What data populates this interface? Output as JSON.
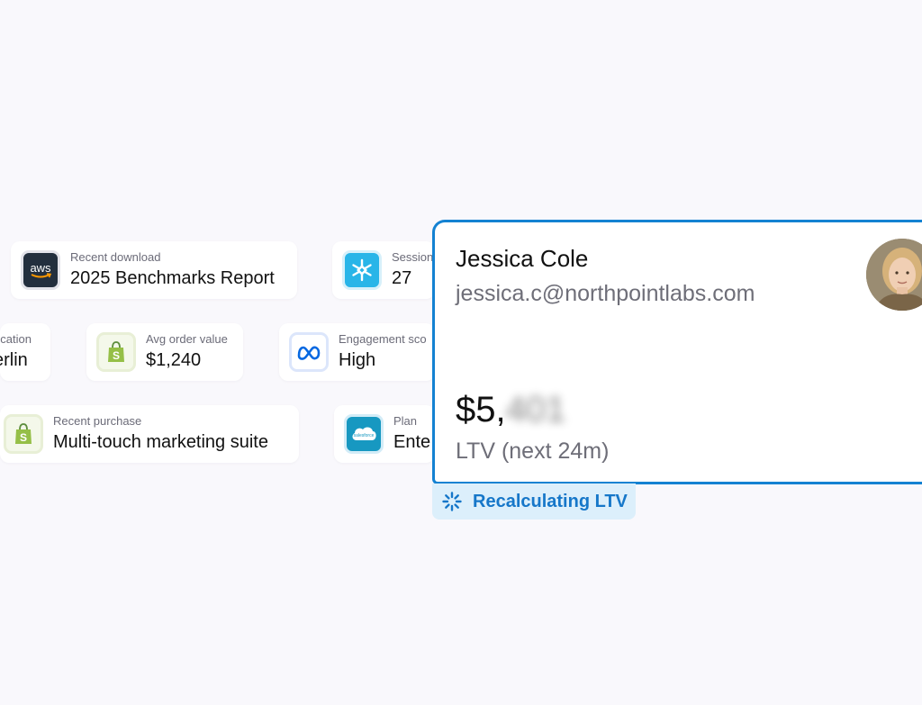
{
  "cards": {
    "recent_download": {
      "label": "Recent download",
      "value": "2025 Benchmarks Report"
    },
    "sessions": {
      "label": "Session",
      "value": "27"
    },
    "location": {
      "label": "ocation",
      "value": "erlin"
    },
    "avg_order": {
      "label": "Avg order value",
      "value": "$1,240"
    },
    "engagement": {
      "label": "Engagement sco",
      "value": "High"
    },
    "recent_purchase": {
      "label": "Recent purchase",
      "value": "Multi-touch marketing suite"
    },
    "plan": {
      "label": "Plan",
      "value": "Ente"
    }
  },
  "icons": {
    "aws": {
      "name": "aws-icon",
      "text": "aws"
    },
    "snowflake": {
      "name": "snowflake-icon"
    },
    "shopify": {
      "name": "shopify-icon"
    },
    "meta": {
      "name": "meta-icon"
    },
    "salesforce": {
      "name": "salesforce-icon",
      "text": "salesforce"
    }
  },
  "profile": {
    "name": "Jessica Cole",
    "email": "jessica.c@northpointlabs.com",
    "ltv_visible": "$5,",
    "ltv_blurred": "401",
    "ltv_label": "LTV (next 24m)"
  },
  "status": {
    "text": "Recalculating LTV"
  },
  "colors": {
    "accent": "#1482d2",
    "status_bg": "#dceffb",
    "status_text": "#1677c9",
    "page_bg": "#f9f8fc"
  }
}
